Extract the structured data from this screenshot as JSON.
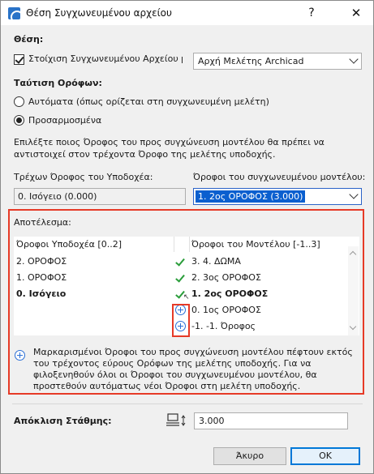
{
  "window": {
    "title": "Θέση Συγχωνευμένου αρχείου",
    "help_label": "?",
    "close_label": "✕"
  },
  "position": {
    "section_label": "Θέση:",
    "align_checkbox_label": "Στοίχιση Συγχωνευμένου Αρχείου με:",
    "align_checked": true,
    "align_dropdown_value": "Αρχή Μελέτης Archicad"
  },
  "floor_mapping": {
    "section_label": "Ταύτιση Ορόφων:",
    "radio_auto_label": "Αυτόματα (όπως ορίζεται στη συγχωνευμένη μελέτη)",
    "radio_custom_label": "Προσαρμοσμένα",
    "selected": "custom",
    "instructions": "Επιλέξτε ποιος Όροφος του προς συγχώνευση μοντέλου θα πρέπει να αντιστοιχεί στον τρέχοντα Όροφο της μελέτης υποδοχής.",
    "host_label": "Τρέχων Όροφος του Υποδοχέα:",
    "host_value": "0. Ισόγειο (0.000)",
    "merged_label": "Όροφοι του συγχωνευμένου μοντέλου:",
    "merged_value": "1. 2ος ΟΡΟΦΟΣ (3.000)"
  },
  "result": {
    "section_label": "Αποτέλεσμα:",
    "col_host": "Όροφοι Υποδοχέα [0..2]",
    "col_model": "Όροφοι του Μοντέλου [-1..3]",
    "rows": [
      {
        "host": "2. ΟΡΟΦΟΣ",
        "mark": "check",
        "model": "3. 4. ΔΩΜΑ",
        "current": false
      },
      {
        "host": "1. ΟΡΟΦΟΣ",
        "mark": "check",
        "model": "2. 3ος ΟΡΟΦΟΣ",
        "current": false
      },
      {
        "host": "0. Ισόγειο",
        "mark": "check",
        "model": "1. 2ος ΟΡΟΦΟΣ",
        "current": true
      },
      {
        "host": "",
        "mark": "plus",
        "model": "0. 1ος ΟΡΟΦΟΣ",
        "current": false
      },
      {
        "host": "",
        "mark": "plus",
        "model": "-1. -1. Όροφος",
        "current": false
      }
    ],
    "info": "Μαρκαρισμένοι Όροφοι του προς συγχώνευση μοντέλου πέφτουν εκτός του τρέχοντος εύρους Ορόφων της μελέτης υποδοχής. Για να φιλοξενηθούν όλοι οι Όροφοι του συγχωνευμένου μοντέλου, θα προστεθούν αυτόματως νέοι Όροφοι στη μελέτη υποδοχής."
  },
  "elevation": {
    "label": "Απόκλιση Στάθμης:",
    "value": "3.000"
  },
  "buttons": {
    "cancel": "Άκυρο",
    "ok": "OK"
  },
  "colors": {
    "highlight": "#e63a27",
    "check": "#2a9d3a",
    "plus": "#2a6fd6",
    "selection": "#0a5fcf"
  }
}
